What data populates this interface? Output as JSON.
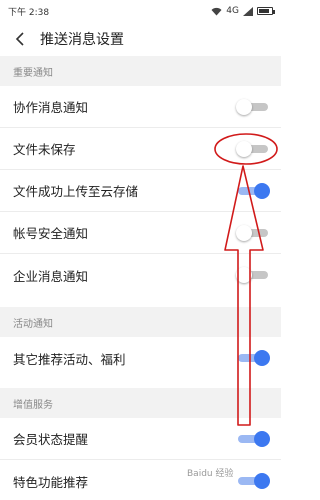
{
  "status_bar": {
    "time": "下午 2:38",
    "network": "4G"
  },
  "header": {
    "title": "推送消息设置"
  },
  "sections": [
    {
      "title": "重要通知"
    },
    {
      "title": "活动通知"
    },
    {
      "title": "增值服务"
    }
  ],
  "rows": [
    {
      "label": "协作消息通知",
      "enabled": false
    },
    {
      "label": "文件未保存",
      "enabled": false
    },
    {
      "label": "文件成功上传至云存储",
      "enabled": true
    },
    {
      "label": "帐号安全通知",
      "enabled": false
    },
    {
      "label": "企业消息通知",
      "enabled": false
    },
    {
      "label": "其它推荐活动、福利",
      "enabled": true
    },
    {
      "label": "会员状态提醒",
      "enabled": true
    },
    {
      "label": "特色功能推荐",
      "enabled": true
    }
  ],
  "annotation_color": "#d11a1a",
  "icons": {
    "back": "chevron-left-icon",
    "wifi": "wifi-icon",
    "signal": "signal-icon",
    "battery": "battery-icon"
  },
  "watermark": "Baidu 经验"
}
